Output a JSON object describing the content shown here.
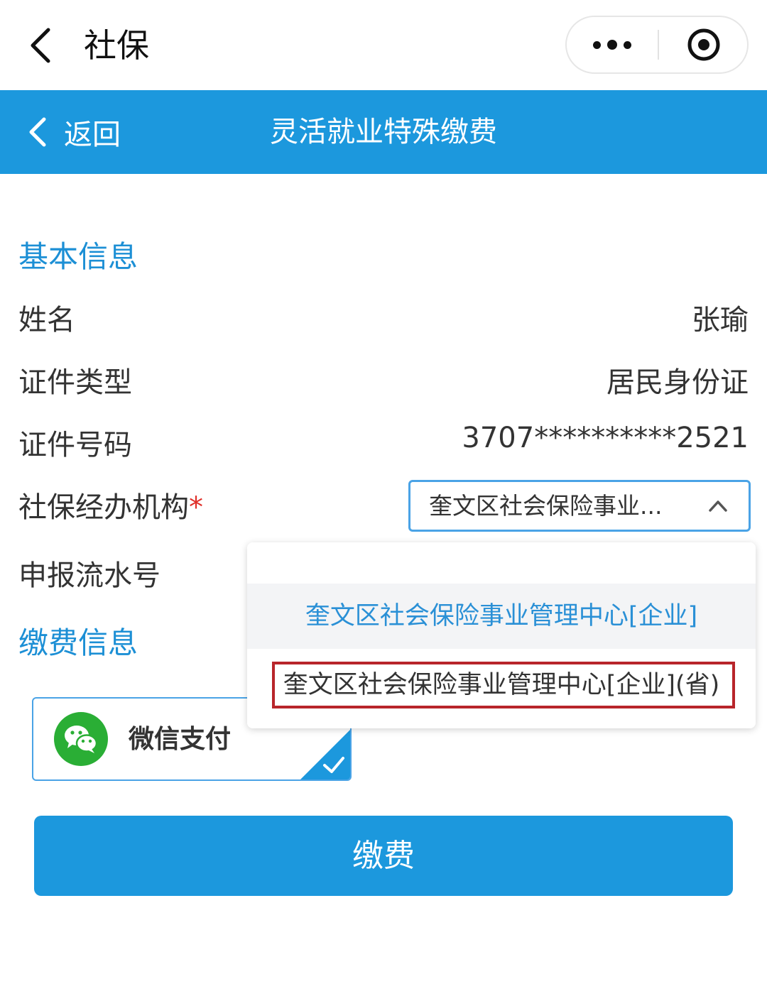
{
  "top_bar": {
    "title": "社保",
    "icons": {
      "back": "back-arrow-icon",
      "more": "more-dots-icon",
      "close": "target-circle-icon"
    }
  },
  "header": {
    "back_label": "返回",
    "title": "灵活就业特殊缴费"
  },
  "basic_info": {
    "section_title": "基本信息",
    "name_label": "姓名",
    "name_value": "张瑜",
    "id_type_label": "证件类型",
    "id_type_value": "居民身份证",
    "id_number_label": "证件号码",
    "id_number_value": "3707**********2521",
    "agency_label": "社保经办机构",
    "agency_required_mark": "*",
    "agency_selected": "奎文区社会保险事业...",
    "serial_label": "申报流水号"
  },
  "dropdown": {
    "options": [
      "",
      "奎文区社会保险事业管理中心[企业]",
      "奎文区社会保险事业管理中心[企业](省)"
    ],
    "highlight_color": "#b8252a"
  },
  "payment_info": {
    "section_title": "缴费信息",
    "method_label": "微信支付",
    "method_icon": "wechat-icon"
  },
  "pay_button_label": "缴费",
  "colors": {
    "primary": "#1c98dd",
    "section_title": "#1c8fd5",
    "wechat_green": "#2aae35",
    "required": "#e0302a"
  }
}
